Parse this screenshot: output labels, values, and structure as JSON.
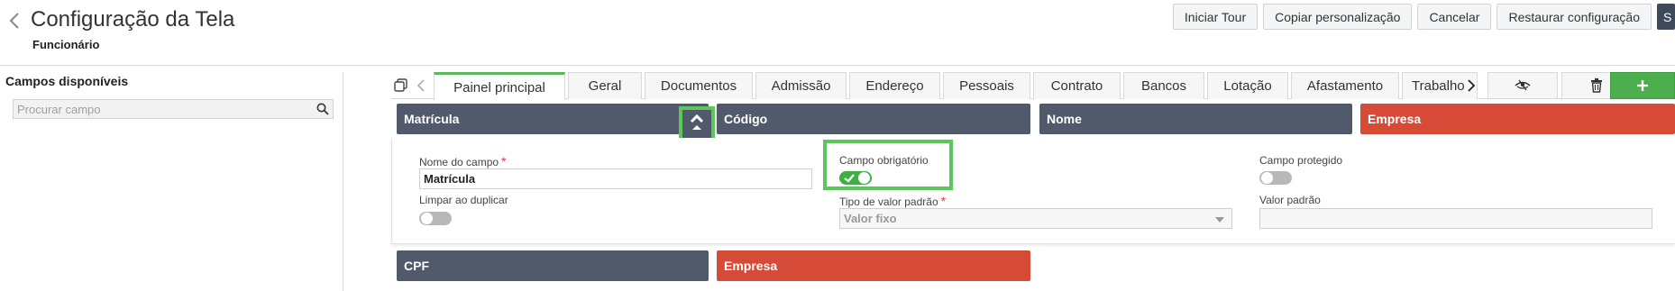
{
  "header": {
    "title": "Configuração da Tela",
    "subtitle": "Funcionário",
    "actions": [
      "Iniciar Tour",
      "Copiar personalização",
      "Cancelar",
      "Restaurar configuração",
      "S"
    ]
  },
  "left_panel": {
    "title": "Campos disponíveis",
    "search_placeholder": "Procurar campo"
  },
  "tabs": {
    "items": [
      "Painel principal",
      "Geral",
      "Documentos",
      "Admissão",
      "Endereço",
      "Pessoais",
      "Contrato",
      "Bancos",
      "Lotação",
      "Afastamento",
      "Trabalho"
    ],
    "active": "Painel principal"
  },
  "fields_row1": [
    "Matrícula",
    "Código",
    "Nome",
    "Empresa"
  ],
  "fields_row2": [
    "CPF",
    "Empresa"
  ],
  "editor": {
    "field_name_label": "Nome do campo",
    "field_name_value": "Matrícula",
    "required_label": "Campo obrigatório",
    "required_on": true,
    "protected_label": "Campo protegido",
    "protected_on": false,
    "clear_on_duplicate_label": "Limpar ao duplicar",
    "clear_on_duplicate_on": false,
    "default_type_label": "Tipo de valor padrão",
    "default_type_value": "Valor fixo",
    "default_value_label": "Valor padrão",
    "default_value": ""
  },
  "colors": {
    "field_gray": "#505a6b",
    "field_red": "#d64a38",
    "accent_green": "#5cc55c",
    "toggle_on": "#3cb043",
    "add_green": "#4cae4c"
  }
}
